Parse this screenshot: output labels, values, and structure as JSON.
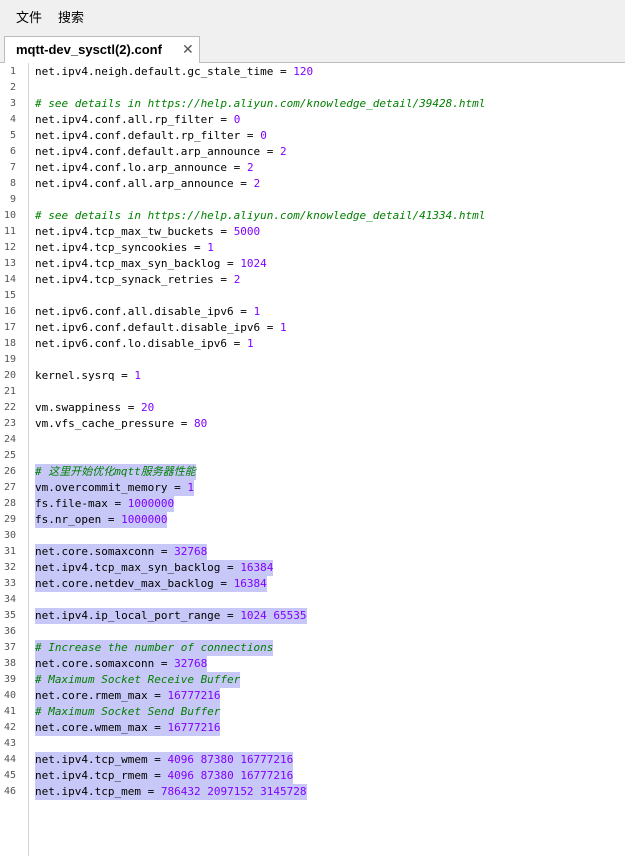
{
  "menu": [
    "文件",
    "搜索"
  ],
  "tab": {
    "title": "mqtt-dev_sysctl(2).conf",
    "close": "✕"
  },
  "lines": [
    {
      "n": "1",
      "type": "kv",
      "key": "net.ipv4.neigh.default.gc_stale_time",
      "val": "120"
    },
    {
      "n": "2",
      "type": "blank"
    },
    {
      "n": "3",
      "type": "comment",
      "text": "# see details in https://help.aliyun.com/knowledge_detail/39428.html"
    },
    {
      "n": "4",
      "type": "kv",
      "key": "net.ipv4.conf.all.rp_filter",
      "val": "0"
    },
    {
      "n": "5",
      "type": "kv",
      "key": "net.ipv4.conf.default.rp_filter",
      "val": "0"
    },
    {
      "n": "6",
      "type": "kv",
      "key": "net.ipv4.conf.default.arp_announce",
      "val": "2"
    },
    {
      "n": "7",
      "type": "kv",
      "key": "net.ipv4.conf.lo.arp_announce",
      "val": "2"
    },
    {
      "n": "8",
      "type": "kv",
      "key": "net.ipv4.conf.all.arp_announce",
      "val": "2"
    },
    {
      "n": "9",
      "type": "blank"
    },
    {
      "n": "10",
      "type": "comment",
      "text": "# see details in https://help.aliyun.com/knowledge_detail/41334.html"
    },
    {
      "n": "11",
      "type": "kv",
      "key": "net.ipv4.tcp_max_tw_buckets",
      "val": "5000"
    },
    {
      "n": "12",
      "type": "kv",
      "key": "net.ipv4.tcp_syncookies",
      "val": "1"
    },
    {
      "n": "13",
      "type": "kv",
      "key": "net.ipv4.tcp_max_syn_backlog",
      "val": "1024"
    },
    {
      "n": "14",
      "type": "kv",
      "key": "net.ipv4.tcp_synack_retries",
      "val": "2"
    },
    {
      "n": "15",
      "type": "blank"
    },
    {
      "n": "16",
      "type": "kv",
      "key": "net.ipv6.conf.all.disable_ipv6",
      "val": "1"
    },
    {
      "n": "17",
      "type": "kv",
      "key": "net.ipv6.conf.default.disable_ipv6",
      "val": "1"
    },
    {
      "n": "18",
      "type": "kv",
      "key": "net.ipv6.conf.lo.disable_ipv6",
      "val": "1"
    },
    {
      "n": "19",
      "type": "blank"
    },
    {
      "n": "20",
      "type": "kv",
      "key": "kernel.sysrq",
      "val": "1"
    },
    {
      "n": "21",
      "type": "blank"
    },
    {
      "n": "22",
      "type": "kv",
      "key": "vm.swappiness",
      "val": "20"
    },
    {
      "n": "23",
      "type": "kv",
      "key": "vm.vfs_cache_pressure",
      "val": "80"
    },
    {
      "n": "24",
      "type": "blank"
    },
    {
      "n": "25",
      "type": "blank"
    },
    {
      "n": "26",
      "type": "comment",
      "text": "# 这里开始优化mqtt服务器性能",
      "sel": true
    },
    {
      "n": "27",
      "type": "kv",
      "key": "vm.overcommit_memory",
      "val": "1",
      "sel": true
    },
    {
      "n": "28",
      "type": "kv",
      "key": "fs.file-max",
      "val": "1000000",
      "sel": true
    },
    {
      "n": "29",
      "type": "kv",
      "key": "fs.nr_open",
      "val": "1000000",
      "sel": true
    },
    {
      "n": "30",
      "type": "blank"
    },
    {
      "n": "31",
      "type": "kv",
      "key": "net.core.somaxconn",
      "val": "32768",
      "sel": true
    },
    {
      "n": "32",
      "type": "kv",
      "key": "net.ipv4.tcp_max_syn_backlog",
      "val": "16384",
      "sel": true
    },
    {
      "n": "33",
      "type": "kv",
      "key": "net.core.netdev_max_backlog",
      "val": "16384",
      "sel": true
    },
    {
      "n": "34",
      "type": "blank"
    },
    {
      "n": "35",
      "type": "kv",
      "key": "net.ipv4.ip_local_port_range",
      "val": "1024 65535",
      "sel": true
    },
    {
      "n": "36",
      "type": "blank"
    },
    {
      "n": "37",
      "type": "comment",
      "text": "# Increase the number of connections",
      "sel": true
    },
    {
      "n": "38",
      "type": "kv",
      "key": "net.core.somaxconn",
      "val": "32768",
      "sel": true
    },
    {
      "n": "39",
      "type": "comment",
      "text": "# Maximum Socket Receive Buffer",
      "sel": true
    },
    {
      "n": "40",
      "type": "kv",
      "key": "net.core.rmem_max",
      "val": "16777216",
      "sel": true
    },
    {
      "n": "41",
      "type": "comment",
      "text": "# Maximum Socket Send Buffer",
      "sel": true
    },
    {
      "n": "42",
      "type": "kv",
      "key": "net.core.wmem_max",
      "val": "16777216",
      "sel": true
    },
    {
      "n": "43",
      "type": "blank"
    },
    {
      "n": "44",
      "type": "kv",
      "key": "net.ipv4.tcp_wmem",
      "val": "4096 87380 16777216",
      "sel": true
    },
    {
      "n": "45",
      "type": "kv",
      "key": "net.ipv4.tcp_rmem",
      "val": "4096 87380 16777216",
      "sel": true
    },
    {
      "n": "46",
      "type": "kv",
      "key": "net.ipv4.tcp_mem",
      "val": "786432 2097152 3145728",
      "sel": true
    }
  ],
  "colors": {
    "selection": "#c8c8f8",
    "comment": "#008000",
    "number": "#8000ff"
  }
}
